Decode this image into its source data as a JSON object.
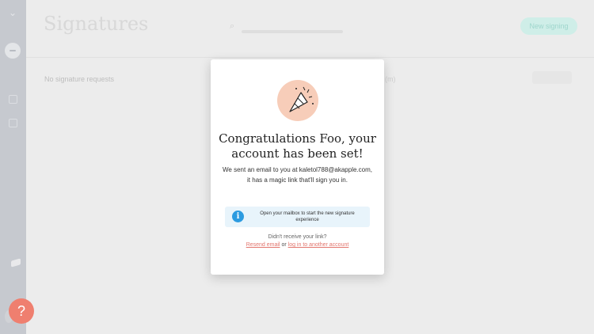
{
  "header": {
    "title": "Signatures",
    "new_button_label": "New signing"
  },
  "main": {
    "empty_text": "No signature requests",
    "ghost_text": "(m)"
  },
  "modal": {
    "title": "Congratulations Foo, your account has been set!",
    "body": "We sent an email to you at kaletol788@akapple.com, it has a magic link that'll sign you in.",
    "info_text": "Open your mailbox to start the new signature experience",
    "didnt_receive": "Didn't receive your link?",
    "resend_label": "Resend email",
    "or_text": "or",
    "login_label": "log in to another account"
  },
  "help": {
    "label": "?"
  },
  "colors": {
    "accent": "#ef7f6f",
    "info": "#2c9be0",
    "party_bg": "#f7cdb9"
  }
}
